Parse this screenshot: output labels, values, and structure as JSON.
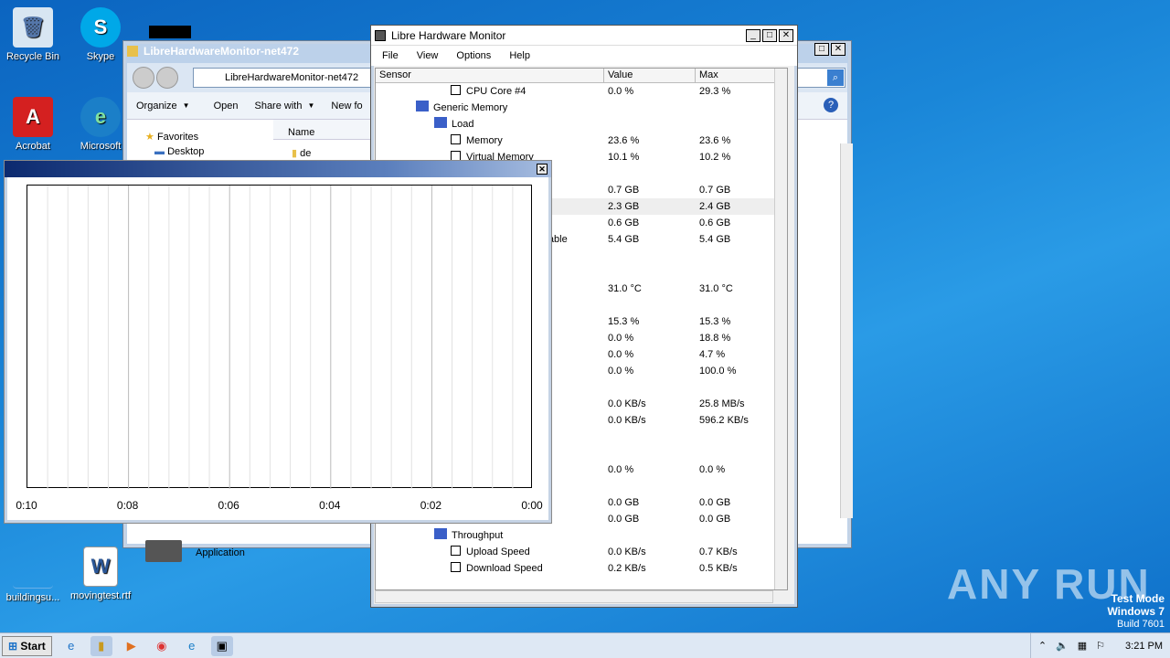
{
  "desktop": {
    "icons": [
      {
        "label": "Recycle Bin",
        "icon": "recycle-bin-icon"
      },
      {
        "label": "Skype",
        "icon": "skype-icon"
      },
      {
        "label": "Acrobat Reader DC",
        "icon": "acrobat-icon"
      },
      {
        "label": "Microsoft Edge",
        "icon": "edge-icon"
      },
      {
        "label": "buildingsu...",
        "icon": "file-icon"
      },
      {
        "label": "movingtest.rtf",
        "icon": "word-doc-icon"
      }
    ],
    "watermark": {
      "brand": "ANY RUN",
      "test_mode": "Test Mode",
      "os": "Windows 7",
      "build": "Build 7601"
    }
  },
  "explorer": {
    "title": "LibreHardwareMonitor-net472",
    "address": "LibreHardwareMonitor-net472",
    "toolbar": {
      "organize": "Organize",
      "open": "Open",
      "share_with": "Share with",
      "new_folder": "New fo"
    },
    "nav": {
      "favorites": "Favorites",
      "desktop": "Desktop"
    },
    "columns": {
      "name": "Name"
    },
    "files": [
      {
        "name": "de"
      }
    ],
    "bottom_item": "Application"
  },
  "lhm": {
    "title": "Libre Hardware Monitor",
    "menu": [
      "File",
      "View",
      "Options",
      "Help"
    ],
    "columns": {
      "sensor": "Sensor",
      "value": "Value",
      "max": "Max"
    },
    "rows": [
      {
        "name": "CPU Core #4",
        "value": "0.0 %",
        "max": "29.3 %",
        "indent": 82,
        "checkbox": true
      },
      {
        "name": "Generic Memory",
        "value": "",
        "max": "",
        "indent": 44,
        "checkbox": false
      },
      {
        "name": "Load",
        "value": "",
        "max": "",
        "indent": 64,
        "checkbox": false
      },
      {
        "name": "Memory",
        "value": "23.6 %",
        "max": "23.6 %",
        "indent": 82,
        "checkbox": true
      },
      {
        "name": "Virtual Memory",
        "value": "10.1 %",
        "max": "10.2 %",
        "indent": 82,
        "checkbox": true
      },
      {
        "name": "",
        "value": "",
        "max": ""
      },
      {
        "name": "",
        "value": "0.7 GB",
        "max": "0.7 GB"
      },
      {
        "name": "",
        "value": "2.3 GB",
        "max": "2.4 GB"
      },
      {
        "name": "d",
        "value": "0.6 GB",
        "max": "0.6 GB"
      },
      {
        "name": "ilable",
        "value": "5.4 GB",
        "max": "5.4 GB"
      },
      {
        "name": "",
        "value": "",
        "max": ""
      },
      {
        "name": "",
        "value": "",
        "max": ""
      },
      {
        "name": "",
        "value": "31.0 °C",
        "max": "31.0 °C"
      },
      {
        "name": "",
        "value": "",
        "max": ""
      },
      {
        "name": "",
        "value": "15.3 %",
        "max": "15.3 %"
      },
      {
        "name": "",
        "value": "0.0 %",
        "max": "18.8 %"
      },
      {
        "name": "",
        "value": "0.0 %",
        "max": "4.7 %"
      },
      {
        "name": "",
        "value": "0.0 %",
        "max": "100.0 %"
      },
      {
        "name": "",
        "value": "",
        "max": ""
      },
      {
        "name": "",
        "value": "0.0 KB/s",
        "max": "25.8 MB/s"
      },
      {
        "name": "",
        "value": "0.0 KB/s",
        "max": "596.2 KB/s"
      },
      {
        "name": "",
        "value": "",
        "max": ""
      },
      {
        "name": "",
        "value": "",
        "max": ""
      },
      {
        "name": "",
        "value": "0.0 %",
        "max": "0.0 %"
      },
      {
        "name": "",
        "value": "",
        "max": ""
      },
      {
        "name": "",
        "value": "0.0 GB",
        "max": "0.0 GB"
      },
      {
        "name": "",
        "value": "0.0 GB",
        "max": "0.0 GB"
      },
      {
        "name": "Throughput",
        "value": "",
        "max": "",
        "indent": 64,
        "checkbox": false
      },
      {
        "name": "Upload Speed",
        "value": "0.0 KB/s",
        "max": "0.7 KB/s",
        "indent": 82,
        "checkbox": true
      },
      {
        "name": "Download Speed",
        "value": "0.2 KB/s",
        "max": "0.5 KB/s",
        "indent": 82,
        "checkbox": true
      }
    ]
  },
  "plot": {
    "x_ticks": [
      "0:10",
      "0:08",
      "0:06",
      "0:04",
      "0:02",
      "0:00"
    ]
  },
  "taskbar": {
    "start": "Start",
    "clock": "3:21 PM"
  }
}
